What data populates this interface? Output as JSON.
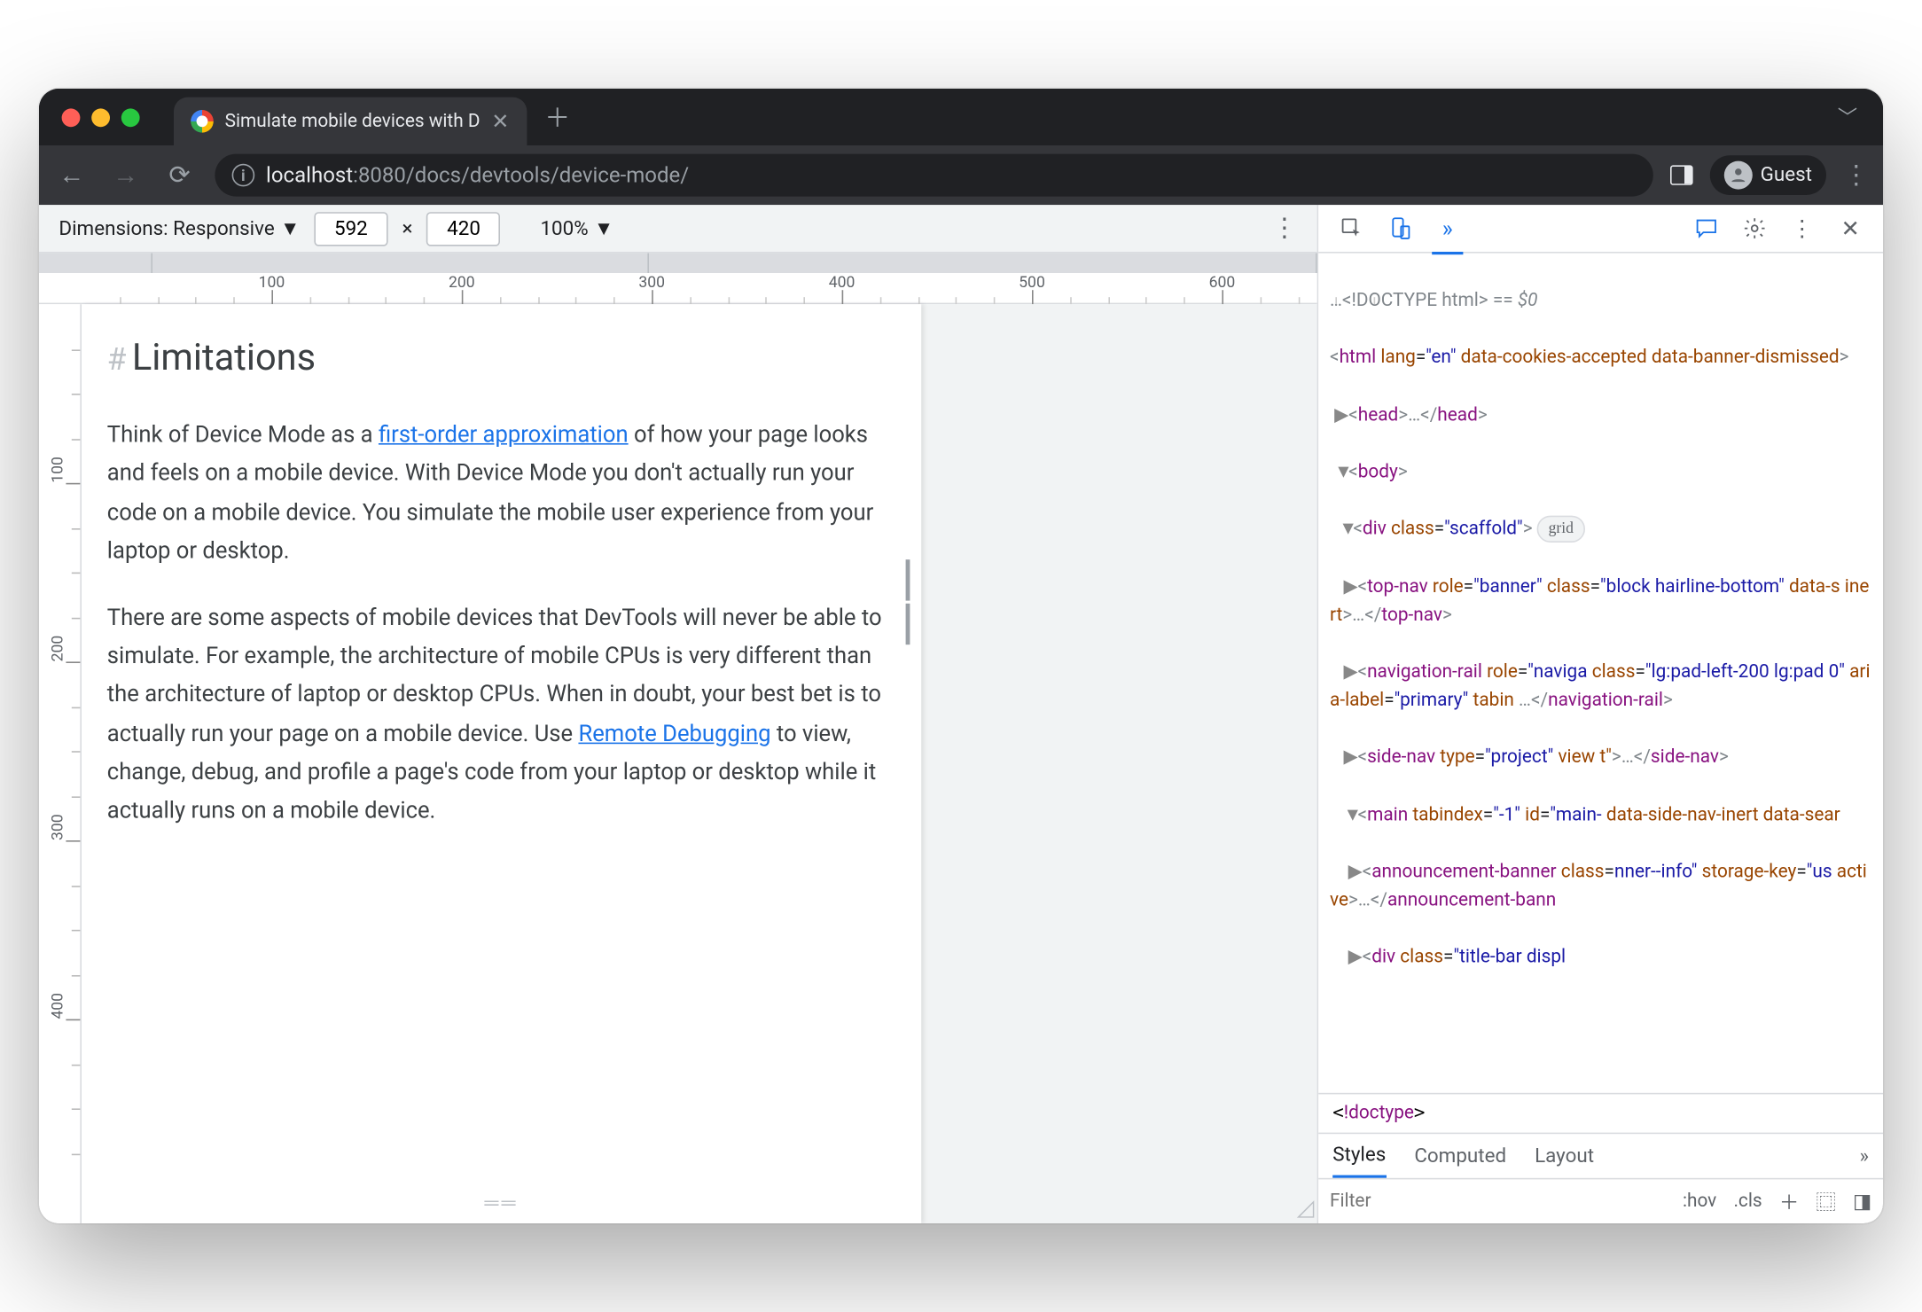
{
  "browser": {
    "tab_title": "Simulate mobile devices with D",
    "url_host": "localhost",
    "url_port": ":8080",
    "url_path": "/docs/devtools/device-mode/",
    "guest_label": "Guest"
  },
  "device_toolbar": {
    "dimensions_label": "Dimensions: Responsive",
    "width": "592",
    "times": "×",
    "height": "420",
    "zoom": "100%"
  },
  "ruler_h": [
    "100",
    "200",
    "300",
    "400",
    "500",
    "600"
  ],
  "ruler_v": [
    "100",
    "200",
    "300",
    "400"
  ],
  "page": {
    "heading_hash": "#",
    "heading": "Limitations",
    "p1a": "Think of Device Mode as a ",
    "p1_link": "first-order approximation",
    "p1b": " of how your page looks and feels on a mobile device. With Device Mode you don't actually run your code on a mobile device. You simulate the mobile user experience from your laptop or desktop.",
    "p2a": "There are some aspects of mobile devices that DevTools will never be able to simulate. For example, the architecture of mobile CPUs is very different than the architecture of laptop or desktop CPUs. When in doubt, your best bet is to actually run your page on a mobile device. Use ",
    "p2_link": "Remote Debugging",
    "p2b": " to view, change, debug, and profile a page's code from your laptop or desktop while it actually runs on a mobile device."
  },
  "dom": {
    "l0": "…<!DOCTYPE html>",
    "l0b": " == ",
    "l0c": "$0",
    "l1": "<html lang=\"en\" data-cookies-accepted data-banner-dismissed>",
    "l2a": "<head>",
    "l2b": "…",
    "l2c": "</head>",
    "l3": "<body>",
    "l4": "<div class=\"scaffold\">",
    "l4_badge": "grid",
    "l5a": "<top-nav role=\"banner\" class=\"block hairline-bottom\" data-s inert>",
    "l5b": "…",
    "l5c": "</top-nav>",
    "l6a": "<navigation-rail role=\"naviga class=\"lg:pad-left-200 lg:pad 0\" aria-label=\"primary\" tabin",
    "l6b": "…",
    "l6c": "</navigation-rail>",
    "l7a": "<side-nav type=\"project\" view t\">",
    "l7b": "…",
    "l7c": "</side-nav>",
    "l8": "<main tabindex=\"-1\" id=\"main- data-side-nav-inert data-sear",
    "l9a": "<announcement-banner class= nner--info\" storage-key=\"us active>",
    "l9b": "…",
    "l9c": "</announcement-bann",
    "l10": "<div class=\"title-bar displ"
  },
  "crumb": "!doctype",
  "styles": {
    "tab1": "Styles",
    "tab2": "Computed",
    "tab3": "Layout",
    "filter_ph": "Filter",
    "hov": ":hov",
    "cls": ".cls"
  }
}
